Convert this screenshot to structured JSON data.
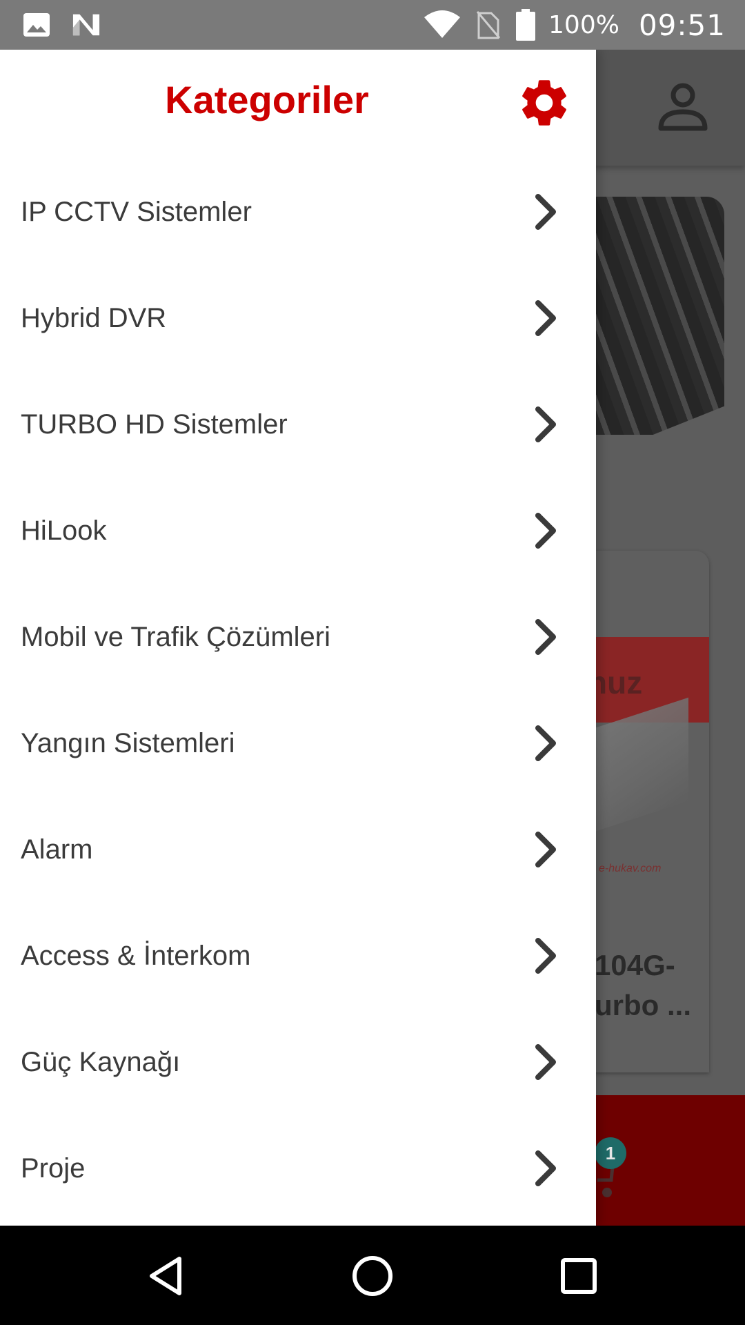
{
  "status_bar": {
    "left_icons": [
      "image-notification-icon",
      "n-notification-icon"
    ],
    "right_icons": [
      "wifi-icon",
      "no-sim-icon",
      "battery-icon"
    ],
    "battery": "100%",
    "time": "09:51"
  },
  "drawer": {
    "title": "Kategoriler",
    "settings_icon": "gear-icon",
    "items": [
      {
        "label": "IP CCTV Sistemler"
      },
      {
        "label": "Hybrid DVR"
      },
      {
        "label": "TURBO HD Sistemler"
      },
      {
        "label": "HiLook"
      },
      {
        "label": "Mobil ve Trafik Çözümleri"
      },
      {
        "label": "Yangın Sistemleri"
      },
      {
        "label": "Alarm"
      },
      {
        "label": "Access & İnterkom"
      },
      {
        "label": "Güç Kaynağı"
      },
      {
        "label": "Proje"
      }
    ],
    "chevron_icon": "chevron-right-icon"
  },
  "background": {
    "profile_icon": "person-icon",
    "card_banner_text": "nuz",
    "brand_text": "e-hukav.com",
    "product_line1": "104G-",
    "product_line2": "urbo ...",
    "cart_icon": "cart-icon",
    "cart_count": "1"
  },
  "nav_bar": {
    "back_icon": "back-triangle-icon",
    "home_icon": "home-circle-icon",
    "recents_icon": "recents-square-icon"
  },
  "colors": {
    "accent": "#cc0000",
    "drawer_text": "#3b3b3b",
    "chevron": "#3a3a3a",
    "status_bar": "#7a7a7a",
    "scrim_background": "#5d5d5d",
    "nav_bar": "#000000"
  }
}
